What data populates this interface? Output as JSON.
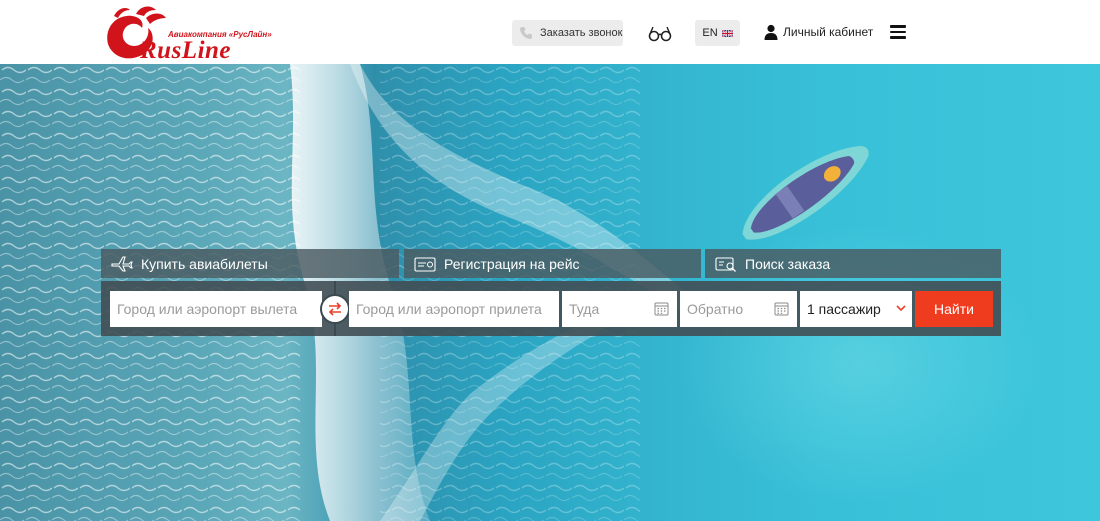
{
  "brand": {
    "subtitle": "Авиакомпания «РусЛайн»",
    "wordmark": "RusLine",
    "color": "#d1141b"
  },
  "header": {
    "callback_label": "Заказать звонок",
    "callback_icon": "phone-icon",
    "accessibility_icon": "glasses-icon",
    "language_label": "EN",
    "language_icon": "uk-flag-icon",
    "account_label": "Личный кабинет",
    "account_icon": "user-icon",
    "menu_icon": "menu-icon"
  },
  "booking": {
    "tabs": [
      {
        "label": "Купить авиабилеты",
        "icon": "airplane-icon"
      },
      {
        "label": "Регистрация на рейс",
        "icon": "boarding-pass-icon"
      },
      {
        "label": "Поиск заказа",
        "icon": "ticket-search-icon"
      }
    ],
    "from_placeholder": "Город или аэропорт вылета",
    "to_placeholder": "Город или аэропорт прилета",
    "depart_placeholder": "Туда",
    "return_placeholder": "Обратно",
    "passengers_value": "1 пассажир",
    "search_label": "Найти",
    "swap_icon": "swap-arrows-icon",
    "calendar_icon": "calendar-icon",
    "accent_color": "#f03c1e",
    "panel_color": "#414e54"
  },
  "hero": {
    "background": "aerial-ocean-boat-photo"
  }
}
